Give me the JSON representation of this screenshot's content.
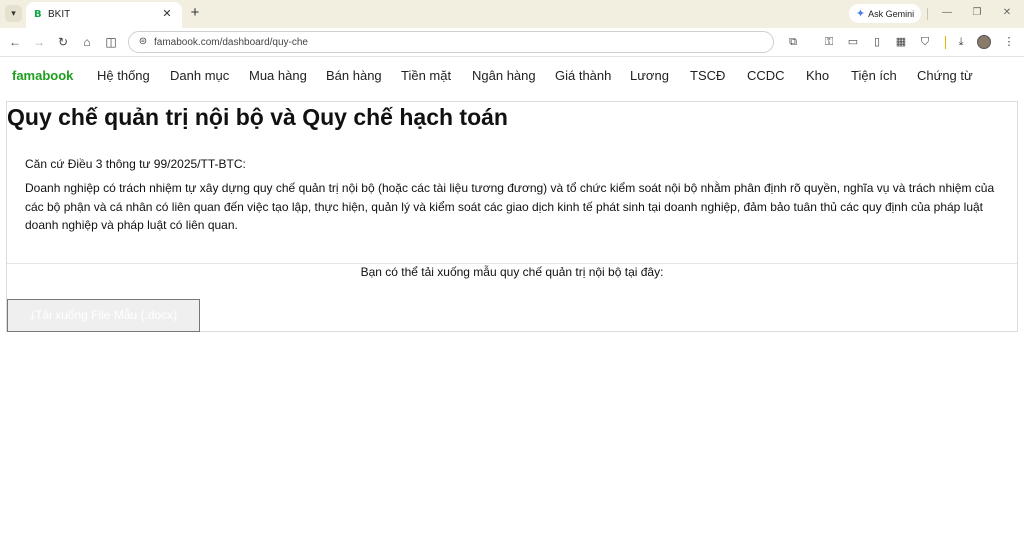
{
  "browser": {
    "tab_title": "BKIT",
    "tab_favicon": "B",
    "ask_gemini_label": "Ask Gemini",
    "url": "famabook.com/dashboard/quy-che",
    "icons": {
      "tab_list": "▾",
      "tab_close": "✕",
      "new_tab": "+",
      "gemini": "✦",
      "minimize": "—",
      "restore": "❐",
      "close": "✕",
      "back": "←",
      "forward": "→",
      "reload": "↻",
      "home": "⌂",
      "split": "◫",
      "site_info": "⊜",
      "extensions": "⧉",
      "passwords": "⚿",
      "payment": "▭",
      "reading": "▯",
      "tab_groups": "▦",
      "incognito": "⛉",
      "download": "⤓",
      "menu": "⋮"
    }
  },
  "app": {
    "brand": "famabook",
    "menu": [
      "Hệ thống",
      "Danh mục",
      "Mua hàng",
      "Bán hàng",
      "Tiền mặt",
      "Ngân hàng",
      "Giá thành",
      "Lương",
      "TSCĐ",
      "CCDC",
      "Kho",
      "Tiện ích",
      "Chứng từ"
    ]
  },
  "content": {
    "title": "Quy chế quản trị nội bộ và Quy chế hạch toán",
    "basis": "Căn cứ Điều 3 thông tư 99/2025/TT-BTC:",
    "body": "Doanh nghiệp có trách nhiệm tự xây dựng quy chế quản trị nội bộ (hoặc các tài liệu tương đương) và tổ chức kiểm soát nội bộ nhằm phân định rõ quyền, nghĩa vụ và trách nhiệm của các bộ phận và cá nhân có liên quan đến việc tạo lập, thực hiện, quản lý và kiểm soát các giao dịch kinh tế phát sinh tại doanh nghiệp, đảm bảo tuân thủ các quy định của pháp luật doanh nghiệp và pháp luật có liên quan.",
    "download_hint": "Bạn có thể tải xuống mẫu quy chế quản trị nội bộ tại đây:",
    "download_button": "⤓Tải xuống File Mẫu (.docx)"
  },
  "colors": {
    "brand": "#1e9e1e",
    "tabstrip": "#f2eee0"
  }
}
